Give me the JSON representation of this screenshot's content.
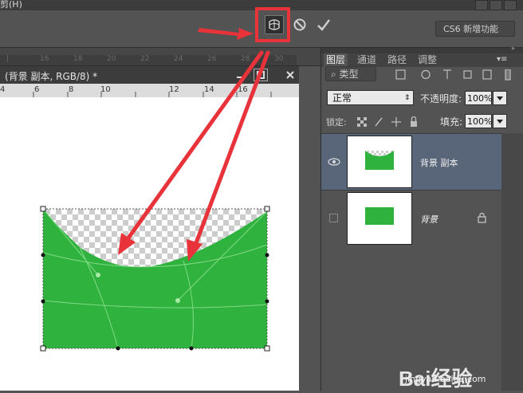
{
  "menubar": {
    "partial_menu": "剪(H)"
  },
  "options_bar": {
    "warp_mode_icon": "warp-mode-icon",
    "cancel_icon": "cancel-circle-icon",
    "commit_icon": "checkmark-icon",
    "workspace": "CS6 新增功能"
  },
  "document": {
    "title": "(背景 副本, RGB/8) *",
    "top_ruler_ticks": [
      "16",
      "18",
      "20",
      "22",
      "24",
      "26",
      "28",
      "30"
    ],
    "ruler_ticks": [
      "6",
      "8",
      "10",
      "12",
      "14",
      "16"
    ],
    "ruler_left_value": "4"
  },
  "layers_panel": {
    "tabs": [
      "图层",
      "通道",
      "路径",
      "调整"
    ],
    "kind_filter": "类型",
    "blend_mode": "正常",
    "opacity_label": "不透明度:",
    "opacity_value": "100%",
    "lock_label": "锁定:",
    "fill_label": "填充:",
    "fill_value": "100%",
    "layers": [
      {
        "name": "背景 副本",
        "visible": true,
        "selected": true
      },
      {
        "name": "背景",
        "visible": false,
        "selected": false,
        "locked": true
      }
    ]
  },
  "colors": {
    "shape_green": "#30b23f",
    "annotation_red": "#e8333a",
    "selected_layer": "#596579"
  },
  "watermark": {
    "logo": "Bai经验",
    "url": "jingyan.baidu.com"
  }
}
